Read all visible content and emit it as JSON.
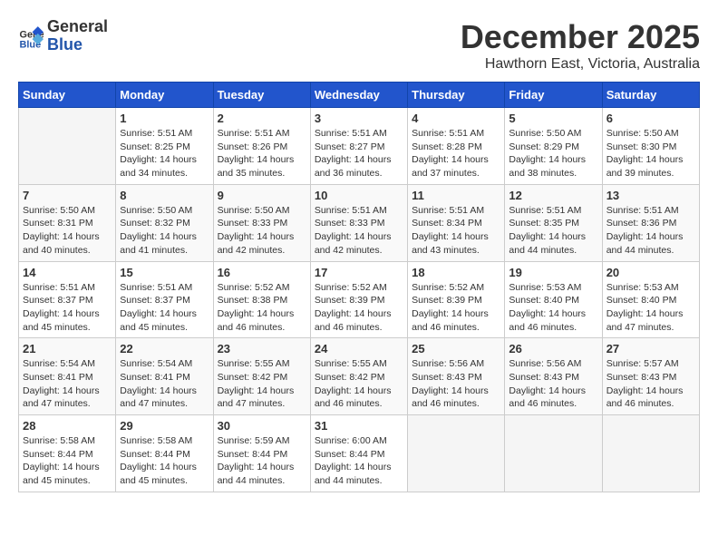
{
  "header": {
    "logo_general": "General",
    "logo_blue": "Blue",
    "month": "December 2025",
    "location": "Hawthorn East, Victoria, Australia"
  },
  "days_of_week": [
    "Sunday",
    "Monday",
    "Tuesday",
    "Wednesday",
    "Thursday",
    "Friday",
    "Saturday"
  ],
  "weeks": [
    [
      {
        "day": "",
        "info": ""
      },
      {
        "day": "1",
        "info": "Sunrise: 5:51 AM\nSunset: 8:25 PM\nDaylight: 14 hours\nand 34 minutes."
      },
      {
        "day": "2",
        "info": "Sunrise: 5:51 AM\nSunset: 8:26 PM\nDaylight: 14 hours\nand 35 minutes."
      },
      {
        "day": "3",
        "info": "Sunrise: 5:51 AM\nSunset: 8:27 PM\nDaylight: 14 hours\nand 36 minutes."
      },
      {
        "day": "4",
        "info": "Sunrise: 5:51 AM\nSunset: 8:28 PM\nDaylight: 14 hours\nand 37 minutes."
      },
      {
        "day": "5",
        "info": "Sunrise: 5:50 AM\nSunset: 8:29 PM\nDaylight: 14 hours\nand 38 minutes."
      },
      {
        "day": "6",
        "info": "Sunrise: 5:50 AM\nSunset: 8:30 PM\nDaylight: 14 hours\nand 39 minutes."
      }
    ],
    [
      {
        "day": "7",
        "info": "Sunrise: 5:50 AM\nSunset: 8:31 PM\nDaylight: 14 hours\nand 40 minutes."
      },
      {
        "day": "8",
        "info": "Sunrise: 5:50 AM\nSunset: 8:32 PM\nDaylight: 14 hours\nand 41 minutes."
      },
      {
        "day": "9",
        "info": "Sunrise: 5:50 AM\nSunset: 8:33 PM\nDaylight: 14 hours\nand 42 minutes."
      },
      {
        "day": "10",
        "info": "Sunrise: 5:51 AM\nSunset: 8:33 PM\nDaylight: 14 hours\nand 42 minutes."
      },
      {
        "day": "11",
        "info": "Sunrise: 5:51 AM\nSunset: 8:34 PM\nDaylight: 14 hours\nand 43 minutes."
      },
      {
        "day": "12",
        "info": "Sunrise: 5:51 AM\nSunset: 8:35 PM\nDaylight: 14 hours\nand 44 minutes."
      },
      {
        "day": "13",
        "info": "Sunrise: 5:51 AM\nSunset: 8:36 PM\nDaylight: 14 hours\nand 44 minutes."
      }
    ],
    [
      {
        "day": "14",
        "info": "Sunrise: 5:51 AM\nSunset: 8:37 PM\nDaylight: 14 hours\nand 45 minutes."
      },
      {
        "day": "15",
        "info": "Sunrise: 5:51 AM\nSunset: 8:37 PM\nDaylight: 14 hours\nand 45 minutes."
      },
      {
        "day": "16",
        "info": "Sunrise: 5:52 AM\nSunset: 8:38 PM\nDaylight: 14 hours\nand 46 minutes."
      },
      {
        "day": "17",
        "info": "Sunrise: 5:52 AM\nSunset: 8:39 PM\nDaylight: 14 hours\nand 46 minutes."
      },
      {
        "day": "18",
        "info": "Sunrise: 5:52 AM\nSunset: 8:39 PM\nDaylight: 14 hours\nand 46 minutes."
      },
      {
        "day": "19",
        "info": "Sunrise: 5:53 AM\nSunset: 8:40 PM\nDaylight: 14 hours\nand 46 minutes."
      },
      {
        "day": "20",
        "info": "Sunrise: 5:53 AM\nSunset: 8:40 PM\nDaylight: 14 hours\nand 47 minutes."
      }
    ],
    [
      {
        "day": "21",
        "info": "Sunrise: 5:54 AM\nSunset: 8:41 PM\nDaylight: 14 hours\nand 47 minutes."
      },
      {
        "day": "22",
        "info": "Sunrise: 5:54 AM\nSunset: 8:41 PM\nDaylight: 14 hours\nand 47 minutes."
      },
      {
        "day": "23",
        "info": "Sunrise: 5:55 AM\nSunset: 8:42 PM\nDaylight: 14 hours\nand 47 minutes."
      },
      {
        "day": "24",
        "info": "Sunrise: 5:55 AM\nSunset: 8:42 PM\nDaylight: 14 hours\nand 46 minutes."
      },
      {
        "day": "25",
        "info": "Sunrise: 5:56 AM\nSunset: 8:43 PM\nDaylight: 14 hours\nand 46 minutes."
      },
      {
        "day": "26",
        "info": "Sunrise: 5:56 AM\nSunset: 8:43 PM\nDaylight: 14 hours\nand 46 minutes."
      },
      {
        "day": "27",
        "info": "Sunrise: 5:57 AM\nSunset: 8:43 PM\nDaylight: 14 hours\nand 46 minutes."
      }
    ],
    [
      {
        "day": "28",
        "info": "Sunrise: 5:58 AM\nSunset: 8:44 PM\nDaylight: 14 hours\nand 45 minutes."
      },
      {
        "day": "29",
        "info": "Sunrise: 5:58 AM\nSunset: 8:44 PM\nDaylight: 14 hours\nand 45 minutes."
      },
      {
        "day": "30",
        "info": "Sunrise: 5:59 AM\nSunset: 8:44 PM\nDaylight: 14 hours\nand 44 minutes."
      },
      {
        "day": "31",
        "info": "Sunrise: 6:00 AM\nSunset: 8:44 PM\nDaylight: 14 hours\nand 44 minutes."
      },
      {
        "day": "",
        "info": ""
      },
      {
        "day": "",
        "info": ""
      },
      {
        "day": "",
        "info": ""
      }
    ]
  ]
}
